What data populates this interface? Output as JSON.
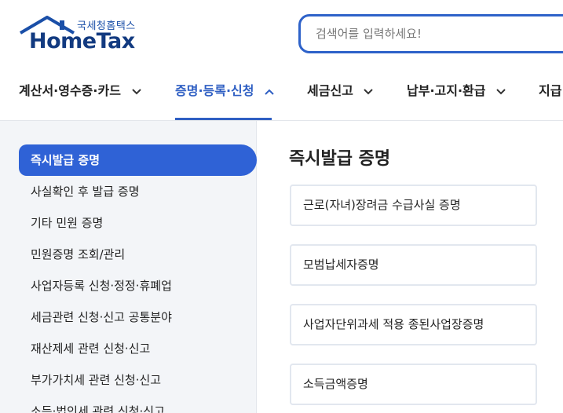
{
  "logo": {
    "small_text": "국세청홈택스",
    "main_text": "HomeTax"
  },
  "search": {
    "placeholder": "검색어를 입력하세요!"
  },
  "colors": {
    "accent": "#2f5fc3",
    "brand_dark": "#123a80",
    "active_bg": "#2f62d6",
    "sidebar_bg": "#f3f5f8"
  },
  "gnb": {
    "items": [
      {
        "label": "계산서·영수증·카드",
        "icon": "chevron-down-icon"
      },
      {
        "label": "증명·등록·신청",
        "icon": "chevron-up-icon",
        "active": true
      },
      {
        "label": "세금신고",
        "icon": "chevron-down-icon"
      },
      {
        "label": "납부·고지·환급",
        "icon": "chevron-down-icon"
      },
      {
        "label": "지급"
      }
    ]
  },
  "sidebar": {
    "items": [
      {
        "label": "즉시발급 증명",
        "active": true
      },
      {
        "label": "사실확인 후 발급 증명"
      },
      {
        "label": "기타 민원 증명"
      },
      {
        "label": "민원증명 조회/관리"
      },
      {
        "label": "사업자등록 신청·정정·휴폐업"
      },
      {
        "label": "세금관련 신청·신고 공통분야"
      },
      {
        "label": "재산제세 관련 신청·신고"
      },
      {
        "label": "부가가치세 관련 신청·신고"
      },
      {
        "label": "소득·법인세 관련 신청·신고"
      }
    ]
  },
  "main": {
    "title": "즉시발급 증명",
    "cards": [
      {
        "label": "근로(자녀)장려금 수급사실 증명"
      },
      {
        "label": "모범납세자증명"
      },
      {
        "label": "사업자단위과세 적용 종된사업장증명"
      },
      {
        "label": "소득금액증명"
      }
    ]
  }
}
